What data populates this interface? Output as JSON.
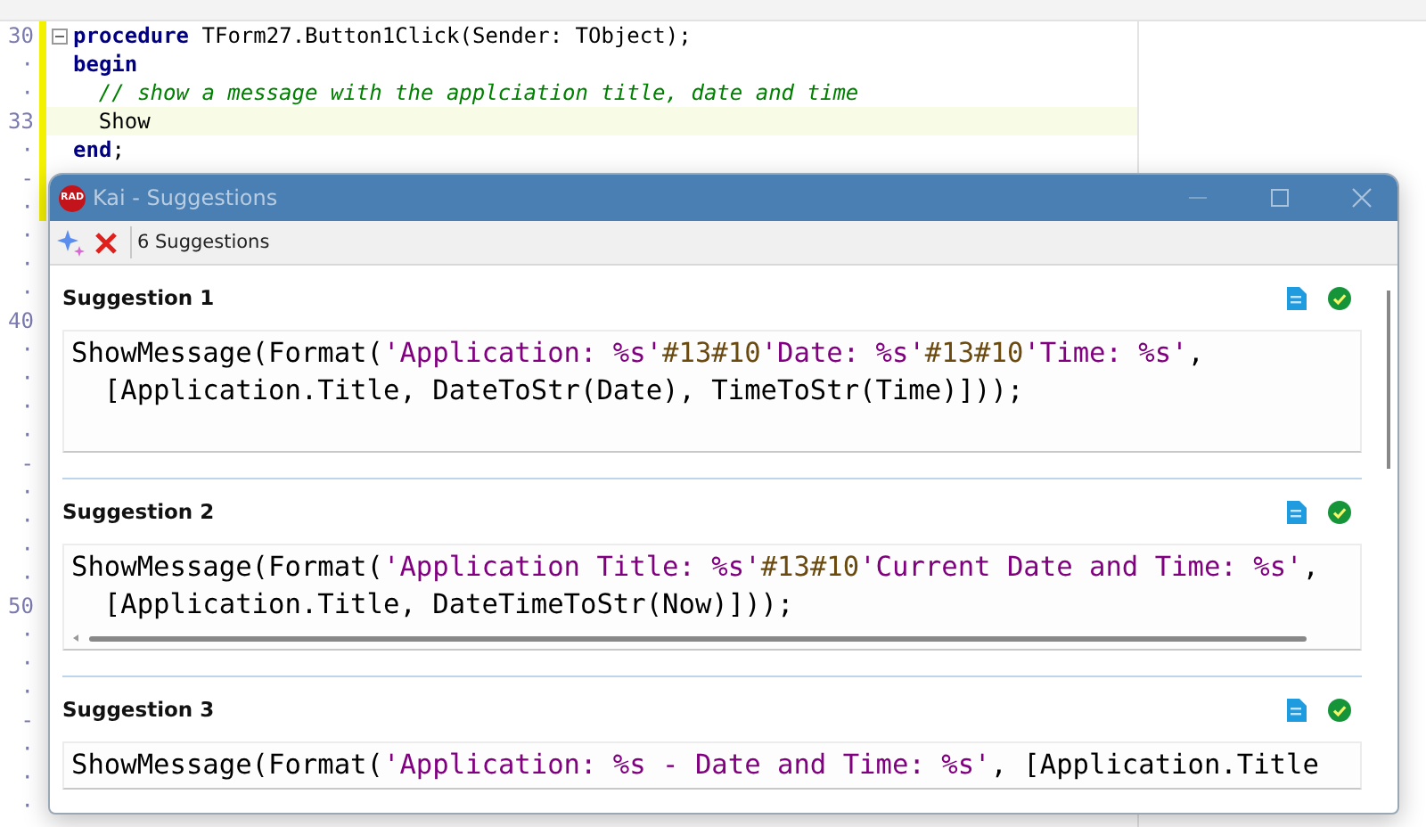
{
  "editor": {
    "gutter": [
      {
        "text": "30",
        "modified": true
      },
      {
        "text": "·",
        "modified": true
      },
      {
        "text": "·",
        "modified": true
      },
      {
        "text": "33",
        "modified": true
      },
      {
        "text": "·",
        "modified": true
      },
      {
        "text": "-",
        "modified": true
      },
      {
        "text": "·",
        "modified": true
      },
      {
        "text": "·",
        "modified": false
      },
      {
        "text": "·",
        "modified": false
      },
      {
        "text": "·",
        "modified": false
      },
      {
        "text": "40",
        "modified": false
      },
      {
        "text": "·",
        "modified": false
      },
      {
        "text": "·",
        "modified": false
      },
      {
        "text": "·",
        "modified": false
      },
      {
        "text": "·",
        "modified": false
      },
      {
        "text": "-",
        "modified": false
      },
      {
        "text": "·",
        "modified": false
      },
      {
        "text": "·",
        "modified": false
      },
      {
        "text": "·",
        "modified": false
      },
      {
        "text": "·",
        "modified": false
      },
      {
        "text": "50",
        "modified": false
      },
      {
        "text": "·",
        "modified": false
      },
      {
        "text": "·",
        "modified": false
      },
      {
        "text": "·",
        "modified": false
      },
      {
        "text": "-",
        "modified": false
      },
      {
        "text": "·",
        "modified": false
      },
      {
        "text": "·",
        "modified": false
      },
      {
        "text": "·",
        "modified": false
      }
    ],
    "lines": [
      {
        "current": false,
        "fold": true,
        "indent": false,
        "tokens": [
          {
            "kind": "keyword",
            "t": "procedure"
          },
          {
            "kind": "plain",
            "t": " TForm27.Button1Click(Sender: TObject);"
          }
        ]
      },
      {
        "current": false,
        "fold": false,
        "indent": false,
        "tokens": [
          {
            "kind": "keyword",
            "t": "begin"
          }
        ]
      },
      {
        "current": false,
        "fold": false,
        "indent": true,
        "tokens": [
          {
            "kind": "comment",
            "t": "// show a message with the applciation title, date and time"
          }
        ]
      },
      {
        "current": true,
        "fold": false,
        "indent": true,
        "tokens": [
          {
            "kind": "plain",
            "t": "Show"
          }
        ]
      },
      {
        "current": false,
        "fold": false,
        "indent": false,
        "tokens": [
          {
            "kind": "keyword",
            "t": "end"
          },
          {
            "kind": "plain",
            "t": ";"
          }
        ]
      }
    ]
  },
  "dialog": {
    "app_icon_text": "RAD",
    "title": "Kai - Suggestions",
    "count": "6 Suggestions",
    "suggestions": [
      {
        "title": "Suggestion 1",
        "scrollable": false,
        "lines": [
          [
            {
              "kind": "plain",
              "t": "ShowMessage(Format("
            },
            {
              "kind": "string",
              "t": "'Application: %s'"
            },
            {
              "kind": "char",
              "t": "#13#10"
            },
            {
              "kind": "string",
              "t": "'Date: %s'"
            },
            {
              "kind": "char",
              "t": "#13#10"
            },
            {
              "kind": "string",
              "t": "'Time: %s'"
            },
            {
              "kind": "plain",
              "t": ","
            }
          ],
          [
            {
              "kind": "plain",
              "t": "  [Application.Title, DateToStr(Date), TimeToStr(Time)]));"
            }
          ]
        ]
      },
      {
        "title": "Suggestion 2",
        "scrollable": true,
        "lines": [
          [
            {
              "kind": "plain",
              "t": "ShowMessage(Format("
            },
            {
              "kind": "string",
              "t": "'Application Title: %s'"
            },
            {
              "kind": "char",
              "t": "#13#10"
            },
            {
              "kind": "string",
              "t": "'Current Date and Time: %s'"
            },
            {
              "kind": "plain",
              "t": ","
            }
          ],
          [
            {
              "kind": "plain",
              "t": "  [Application.Title, DateTimeToStr(Now)]));"
            }
          ]
        ]
      },
      {
        "title": "Suggestion 3",
        "scrollable": false,
        "lines": [
          [
            {
              "kind": "plain",
              "t": "ShowMessage(Format("
            },
            {
              "kind": "string",
              "t": "'Application: %s - Date and Time: %s'"
            },
            {
              "kind": "plain",
              "t": ", [Application.Title"
            }
          ]
        ]
      }
    ]
  }
}
